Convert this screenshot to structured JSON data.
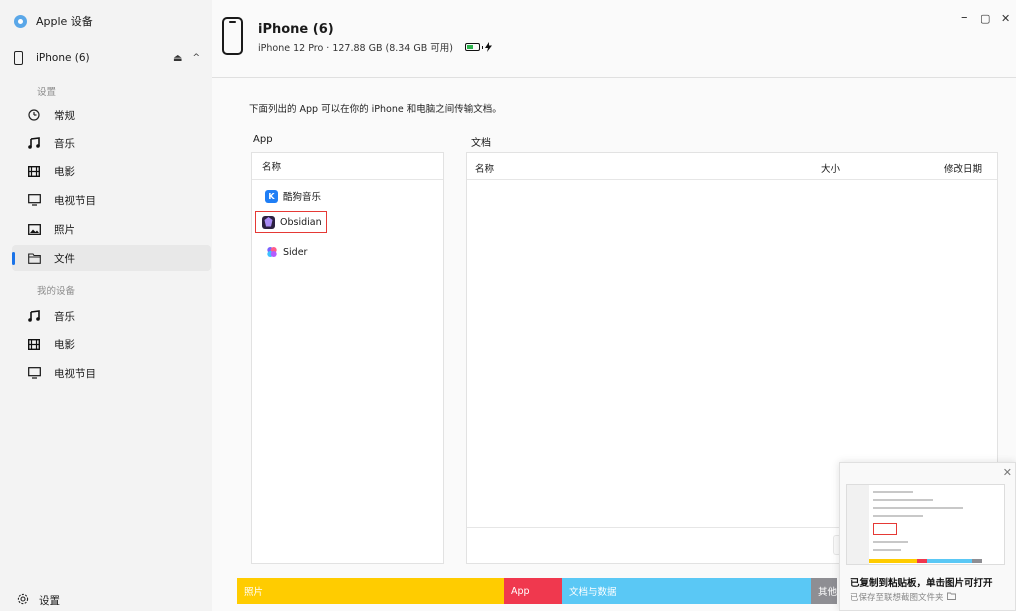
{
  "sidebar": {
    "app_title": "Apple 设备",
    "device_name": "iPhone (6)",
    "section_settings": "设置",
    "settings_items": [
      {
        "label": "常规",
        "icon": "general-icon"
      },
      {
        "label": "音乐",
        "icon": "music-icon"
      },
      {
        "label": "电影",
        "icon": "film-icon"
      },
      {
        "label": "电视节目",
        "icon": "tv-icon"
      },
      {
        "label": "照片",
        "icon": "photo-icon"
      },
      {
        "label": "文件",
        "icon": "folder-icon",
        "active": true
      }
    ],
    "section_my_device": "我的设备",
    "device_items": [
      {
        "label": "音乐",
        "icon": "music-icon"
      },
      {
        "label": "电影",
        "icon": "film-icon"
      },
      {
        "label": "电视节目",
        "icon": "tv-icon"
      }
    ],
    "settings_label": "设置"
  },
  "header": {
    "title": "iPhone (6)",
    "subtitle": "iPhone 12 Pro · 127.88 GB (8.34 GB 可用)",
    "battery_color": "#2bb24c"
  },
  "window_controls": {
    "minimize": "–",
    "maximize": "▢",
    "close": "✕"
  },
  "main": {
    "intro": "下面列出的 App 可以在你的 iPhone 和电脑之间传输文档。",
    "app_label": "App",
    "docs_label": "文档",
    "app_col_name": "名称",
    "apps": [
      {
        "name": "酷狗音乐",
        "icon": "kugou-icon"
      },
      {
        "name": "Obsidian",
        "icon": "obsidian-icon",
        "highlighted": true
      },
      {
        "name": "Sider",
        "icon": "sider-icon"
      }
    ],
    "doc_cols": {
      "name": "名称",
      "size": "大小",
      "modified": "修改日期"
    }
  },
  "storage": {
    "segments": [
      {
        "label": "照片",
        "color": "#ffcc00"
      },
      {
        "label": "App",
        "color": "#f0384e"
      },
      {
        "label": "文档与数据",
        "color": "#5ac8f5"
      },
      {
        "label": "其他",
        "color": "#8e8e93"
      }
    ]
  },
  "toast": {
    "title": "已复制到粘贴板，单击图片可打开",
    "subtitle": "已保存至联想截图文件夹"
  }
}
